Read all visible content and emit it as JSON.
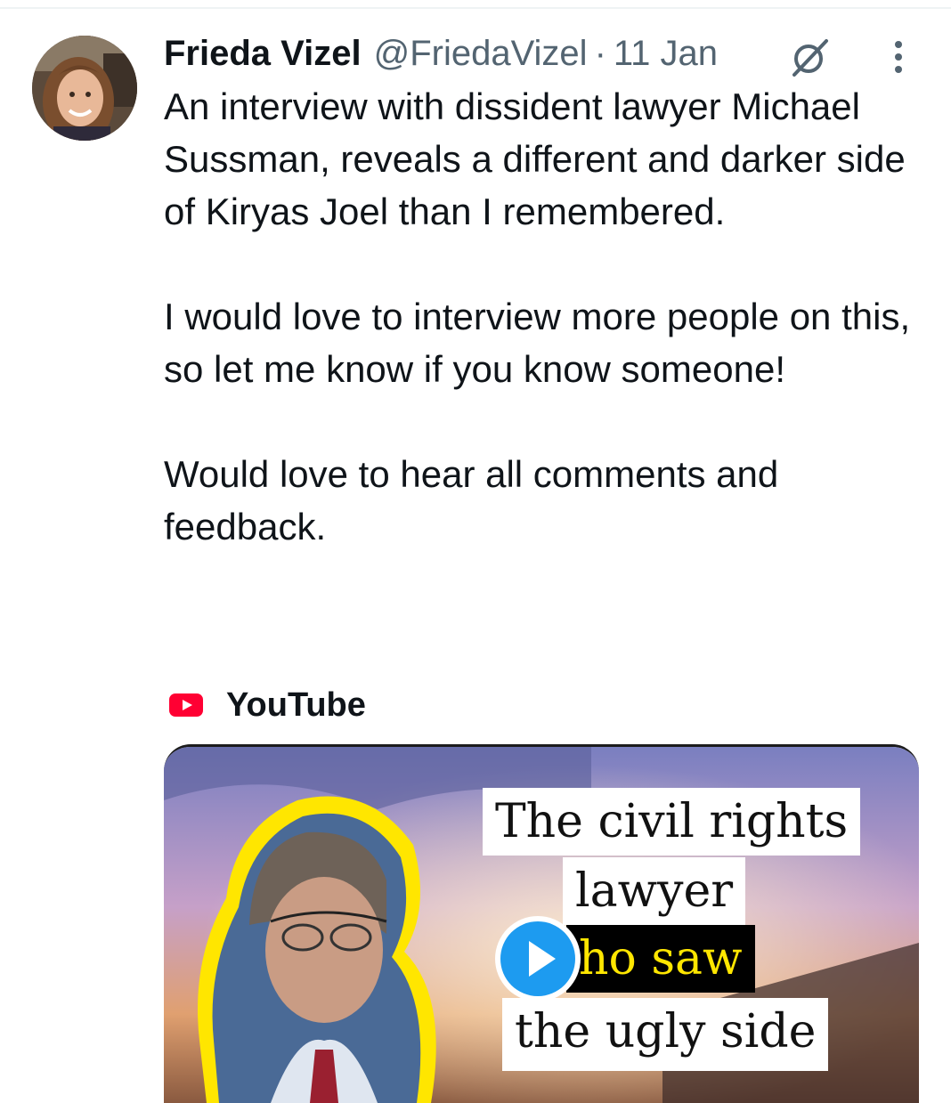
{
  "tweet": {
    "author_name": "Frieda Vizel",
    "handle": "@FriedaVizel",
    "separator": "·",
    "date": "11 Jan",
    "paragraphs": [
      "An interview with dissident lawyer Michael Sussman, reveals a different and darker side of Kiryas Joel than I remembered.",
      "I would love to interview more people on this, so let me know if you know someone!",
      "Would love to hear all comments and feedback."
    ]
  },
  "link_card": {
    "source": "YouTube",
    "thumbnail_text": [
      "The civil rights",
      "lawyer",
      "ho saw",
      "the ugly side"
    ]
  },
  "icons": {
    "grok": "grok-icon",
    "more": "more-options-icon",
    "youtube": "youtube-icon",
    "play": "play-icon"
  },
  "colors": {
    "text": "#0f1419",
    "secondary_text": "#536471",
    "play_button": "#1d9bf0",
    "youtube_red": "#ff0033",
    "highlight_text": "#ffe600"
  }
}
